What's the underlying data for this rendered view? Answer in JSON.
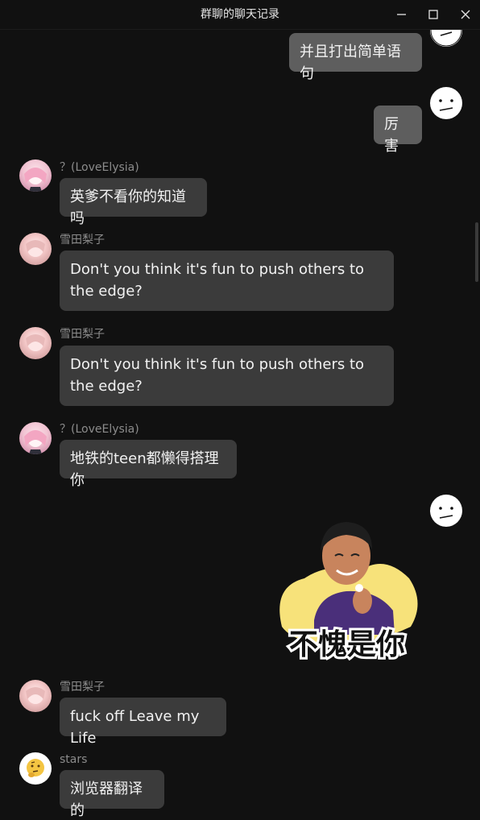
{
  "window": {
    "title": "群聊的聊天记录"
  },
  "messages": [
    {
      "sender": "",
      "text": "并且打出简单语句",
      "mine": true
    },
    {
      "sender": "",
      "text": "厉害",
      "mine": true
    },
    {
      "sender": "？(LoveElysia)",
      "text": "英爹不看你的知道吗",
      "mine": false
    },
    {
      "sender": "雪田梨子",
      "text": "Don't you think it's fun to push others to the edge?",
      "mine": false
    },
    {
      "sender": "雪田梨子",
      "text": "Don't you think it's fun to push others to the edge?",
      "mine": false
    },
    {
      "sender": "？(LoveElysia)",
      "text": "地铁的teen都懒得搭理你",
      "mine": false
    },
    {
      "sender": "",
      "sticker_text": "不愧是你",
      "mine": true
    },
    {
      "sender": "雪田梨子",
      "text": "fuck off Leave my Life",
      "mine": false
    },
    {
      "sender": "stars",
      "text": "浏览器翻译的",
      "mine": false
    }
  ],
  "colors": {
    "background": "#111111",
    "bubble_other": "#3b3b3b",
    "bubble_mine": "#5e5e5e",
    "sender_text": "#8c8c8c"
  },
  "icons": {
    "minimize": "minimize-icon",
    "maximize": "maximize-icon",
    "close": "close-icon",
    "thinking_emoji": "thinking-face-icon"
  }
}
